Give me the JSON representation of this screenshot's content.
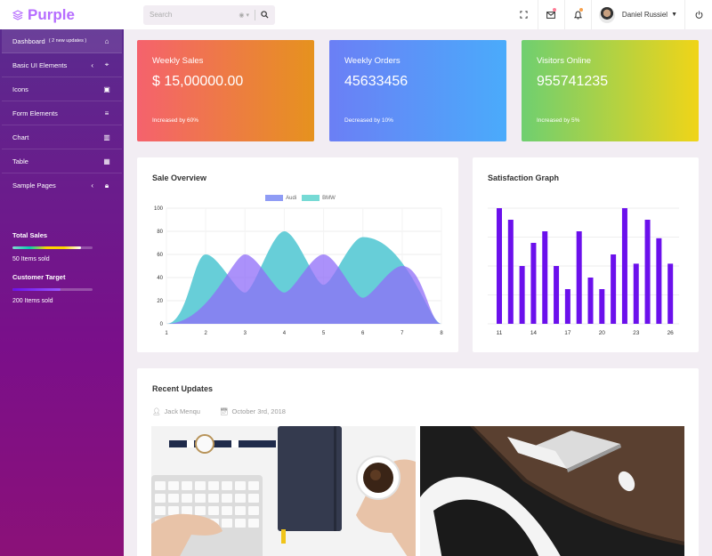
{
  "brand": {
    "name": "Purple"
  },
  "search": {
    "placeholder": "Search"
  },
  "profile": {
    "name": "Daniel Russiel"
  },
  "sidebar": {
    "items": [
      {
        "label": "Dashboard",
        "badge": "( 2 new updates )",
        "icon": "home-icon"
      },
      {
        "label": "Basic UI Elements",
        "icon": "crosshair-icon"
      },
      {
        "label": "Icons",
        "icon": "contacts-icon"
      },
      {
        "label": "Form Elements",
        "icon": "format-list-icon"
      },
      {
        "label": "Chart",
        "icon": "chart-bar-icon"
      },
      {
        "label": "Table",
        "icon": "table-icon"
      },
      {
        "label": "Sample Pages",
        "icon": "lock-icon"
      }
    ],
    "stats": [
      {
        "title": "Total Sales",
        "text": "50 Items sold",
        "progress": 0.85
      },
      {
        "title": "Customer Target",
        "text": "200 Items sold",
        "progress": 0.6
      }
    ]
  },
  "kpis": [
    {
      "label": "Weekly Sales",
      "value": "$ 15,00000.00",
      "sub": "Increased by 60%"
    },
    {
      "label": "Weekly Orders",
      "value": "45633456",
      "sub": "Decreased by 10%"
    },
    {
      "label": "Visitors Online",
      "value": "955741235",
      "sub": "Increased by 5%"
    }
  ],
  "sale_overview": {
    "title": "Sale Overview"
  },
  "satisfaction": {
    "title": "Satisfaction Graph"
  },
  "recent": {
    "title": "Recent Updates",
    "author": "Jack Menqu",
    "date": "October 3rd, 2018"
  },
  "colors": {
    "brand": "#b66dff",
    "audi": "#8f7cf5",
    "bmw": "#76dad5",
    "bars": "#6b10ec"
  },
  "chart_data": [
    {
      "type": "area",
      "title": "Sale Overview",
      "x": [
        1,
        2,
        3,
        4,
        5,
        6,
        7,
        8
      ],
      "ylim": [
        0,
        100
      ],
      "yticks": [
        0,
        20,
        40,
        60,
        80,
        100
      ],
      "legend": "top-center",
      "series": [
        {
          "name": "Audi",
          "peaks": [
            [
              3,
              60
            ],
            [
              5,
              60
            ],
            [
              7,
              50
            ]
          ]
        },
        {
          "name": "BMW",
          "peaks": [
            [
              2,
              60
            ],
            [
              4,
              80
            ],
            [
              6,
              75
            ]
          ]
        }
      ]
    },
    {
      "type": "bar",
      "title": "Satisfaction Graph",
      "x": [
        11,
        12,
        13,
        14,
        15,
        16,
        17,
        18,
        19,
        20,
        21,
        22,
        23,
        24,
        25,
        26
      ],
      "xticks": [
        11,
        14,
        17,
        20,
        23,
        26
      ],
      "values": [
        100,
        90,
        50,
        70,
        80,
        50,
        30,
        80,
        40,
        30,
        60,
        100,
        52,
        90,
        74,
        52
      ],
      "ylim": [
        0,
        100
      ],
      "grid": true
    }
  ]
}
